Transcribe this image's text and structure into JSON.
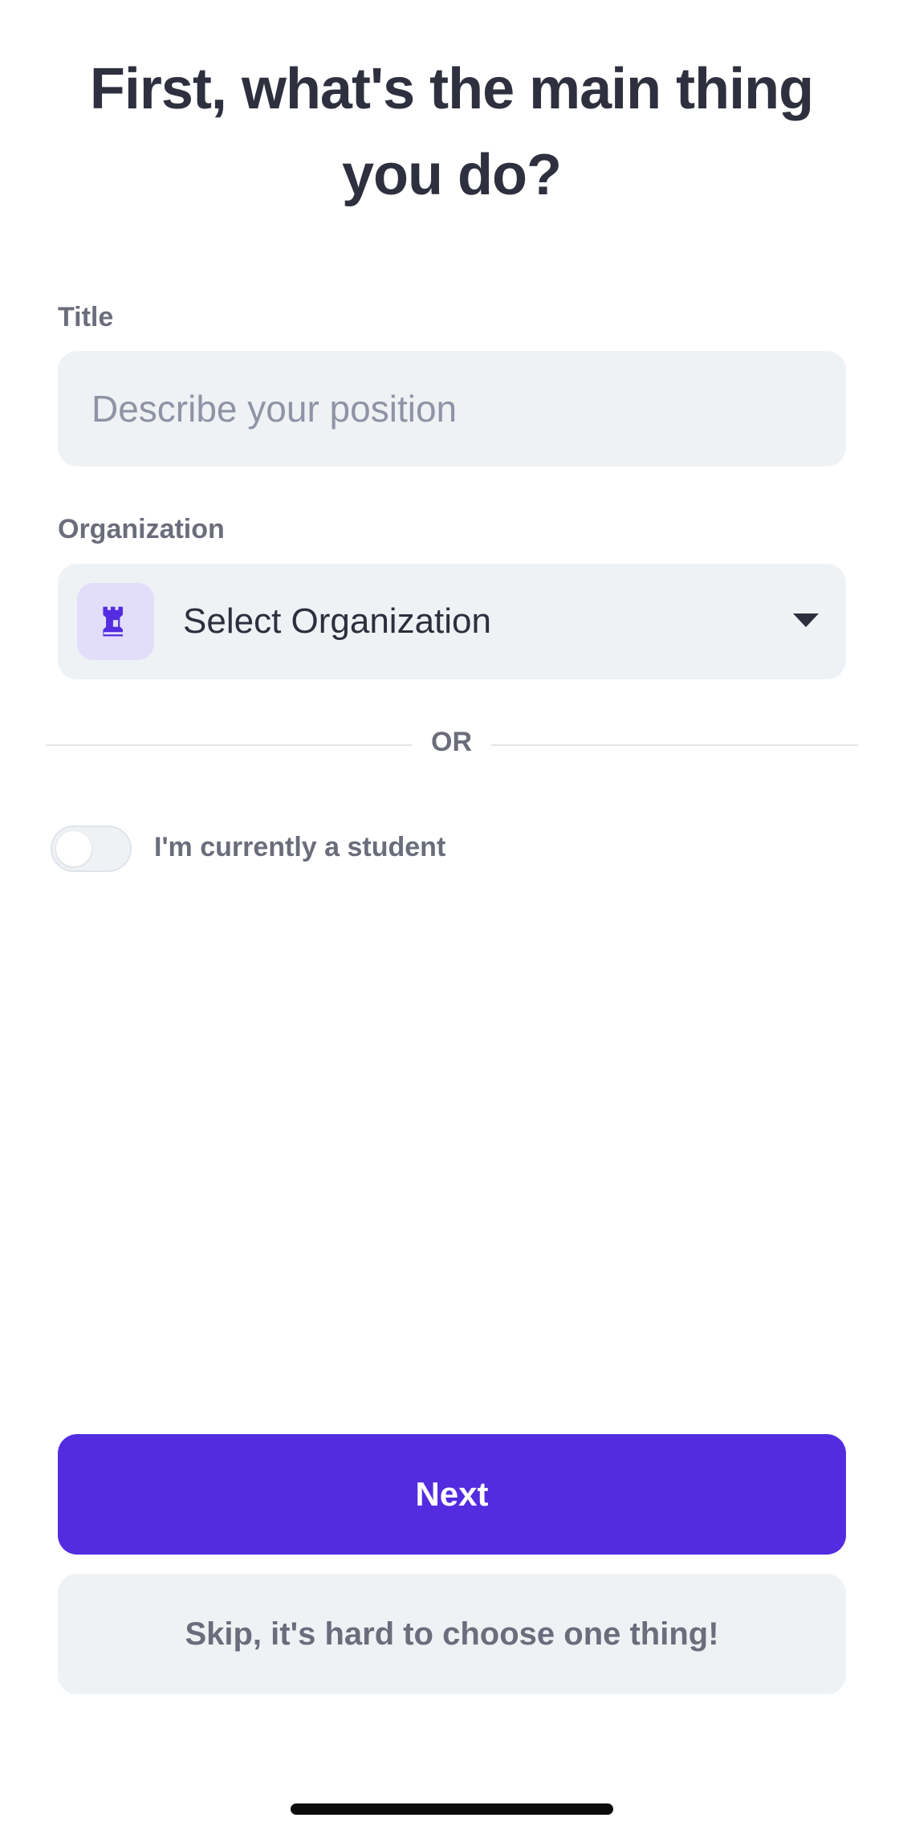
{
  "page": {
    "title": "First, what's the main thing you do?"
  },
  "title_field": {
    "label": "Title",
    "placeholder": "Describe your position",
    "value": ""
  },
  "organization_field": {
    "label": "Organization",
    "select_text": "Select Organization",
    "icon": "castle-icon"
  },
  "divider": {
    "text": "OR"
  },
  "student_toggle": {
    "label": "I'm currently a student",
    "checked": false
  },
  "actions": {
    "next_label": "Next",
    "skip_label": "Skip, it's hard to choose one thing!"
  },
  "colors": {
    "primary": "#532CE0",
    "field_background": "#EFF2F5",
    "icon_background": "#E2DEFA",
    "heading_text": "#2E303F",
    "secondary_text": "#6B6D7C",
    "placeholder_text": "#8F93A6"
  }
}
